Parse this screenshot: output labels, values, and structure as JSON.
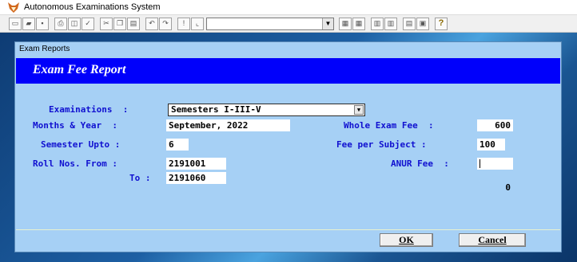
{
  "window": {
    "title": "Autonomous Examinations System"
  },
  "toolbar": {
    "icons": [
      "new-icon",
      "open-icon",
      "save-icon",
      "print-icon",
      "preview-icon",
      "spell-icon",
      "cut-icon",
      "copy-icon",
      "paste-icon",
      "undo-icon",
      "redo-icon",
      "exclaim-icon",
      "chart-icon",
      "table1-icon",
      "table2-icon",
      "tool1-icon",
      "tool2-icon",
      "tool3-icon",
      "tool4-icon",
      "help-icon"
    ],
    "combo_value": "",
    "help_glyph": "?"
  },
  "dialog": {
    "caption": "Exam Reports",
    "header_title": "Exam Fee Report",
    "examinations": {
      "label": "Examinations  :",
      "value": "Semesters I-III-V"
    },
    "months_year": {
      "label": "Months & Year  :",
      "value": "September, 2022"
    },
    "semester_upto": {
      "label": "Semester Upto :",
      "value": "6"
    },
    "roll_from": {
      "label": "Roll Nos. From :",
      "value": "2191001"
    },
    "roll_to": {
      "label": "To :",
      "value": "2191060"
    },
    "whole_exam_fee": {
      "label": "Whole Exam Fee  :",
      "value": "600"
    },
    "fee_per_subject": {
      "label": "Fee per Subject :",
      "value": "100"
    },
    "anur_fee": {
      "label": "ANUR Fee  :",
      "value": "0"
    },
    "ok_label": "OK",
    "cancel_label": "Cancel"
  },
  "colors": {
    "header_bg": "#0000fb",
    "dialog_bg": "#a6d0f5",
    "label_color": "#1010d0"
  }
}
